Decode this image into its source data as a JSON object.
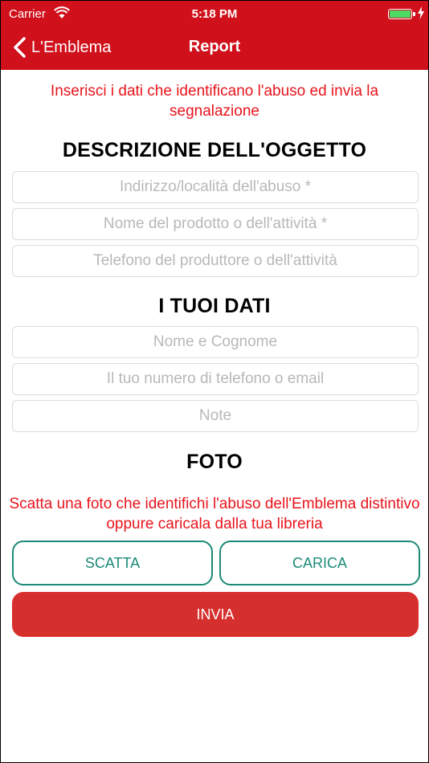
{
  "status_bar": {
    "carrier": "Carrier",
    "time": "5:18 PM",
    "battery_color": "#4cd964"
  },
  "nav": {
    "back_label": "L'Emblema",
    "back_icon": "chevron-left-icon",
    "title": "Report",
    "bar_color": "#d0101b"
  },
  "intro_text": "Inserisci i dati che identificano l'abuso ed invia la segnalazione",
  "object_section": {
    "title": "DESCRIZIONE DELL'OGGETTO",
    "fields": [
      {
        "placeholder": "Indirizzo/località dell'abuso *",
        "value": ""
      },
      {
        "placeholder": "Nome del prodotto o dell'attività *",
        "value": ""
      },
      {
        "placeholder": "Telefono del produttore o dell'attività",
        "value": ""
      }
    ]
  },
  "user_section": {
    "title": "I TUOI DATI",
    "fields": [
      {
        "placeholder": "Nome e Cognome",
        "value": ""
      },
      {
        "placeholder": "Il tuo numero di telefono o email",
        "value": ""
      },
      {
        "placeholder": "Note",
        "value": ""
      }
    ]
  },
  "photo_section": {
    "title": "FOTO",
    "text": "Scatta una foto che identifichi l'abuso dell'Emblema distintivo oppure caricala dalla tua libreria",
    "take_label": "SCATTA",
    "upload_label": "CARICA"
  },
  "send_label": "INVIA",
  "colors": {
    "accent_red": "#e8141c",
    "teal": "#1c8a78",
    "send_button": "#d6302e"
  }
}
